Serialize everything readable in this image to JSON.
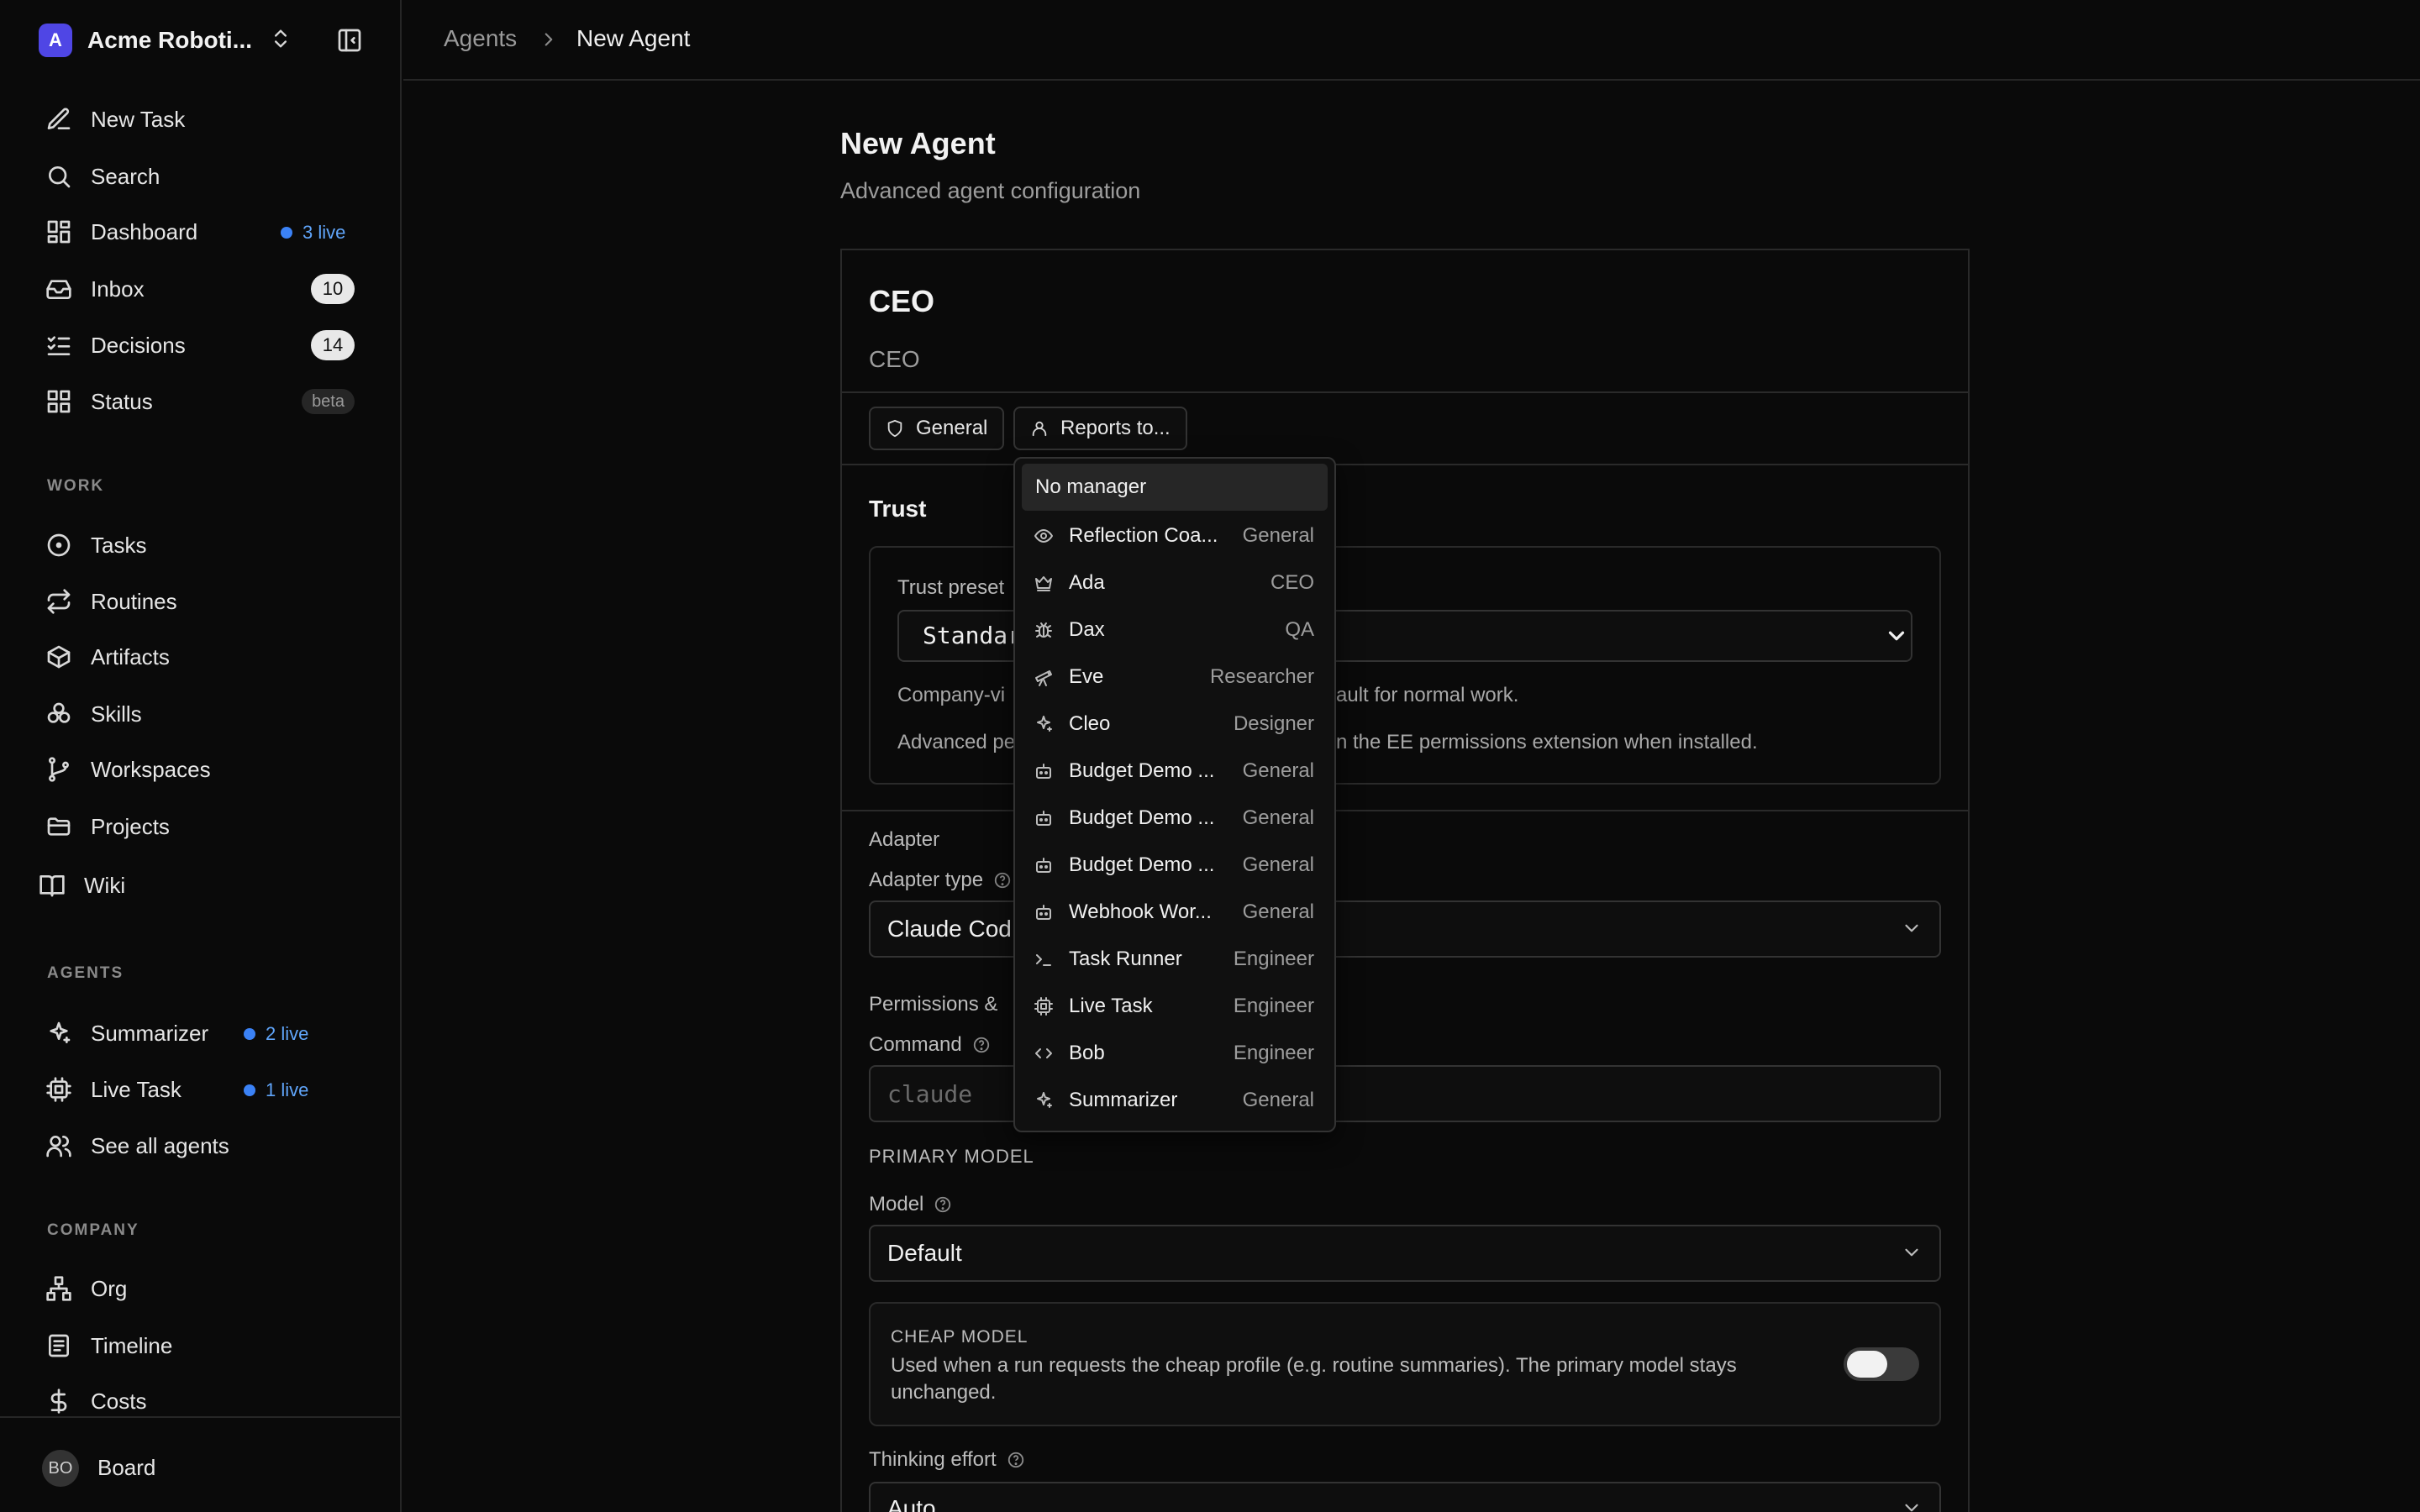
{
  "workspace": {
    "logo_letter": "A",
    "name": "Acme Roboti..."
  },
  "nav": {
    "new_task": "New Task",
    "search": "Search",
    "dashboard": "Dashboard",
    "dashboard_live": "3 live",
    "inbox": "Inbox",
    "inbox_count": "10",
    "decisions": "Decisions",
    "decisions_count": "14",
    "status": "Status",
    "status_badge": "beta"
  },
  "work": {
    "title": "WORK",
    "tasks": "Tasks",
    "routines": "Routines",
    "artifacts": "Artifacts",
    "skills": "Skills",
    "workspaces": "Workspaces",
    "projects": "Projects",
    "wiki": "Wiki"
  },
  "agents_section": {
    "title": "AGENTS",
    "summarizer": "Summarizer",
    "summarizer_live": "2 live",
    "live_task": "Live Task",
    "live_task_live": "1 live",
    "see_all": "See all agents"
  },
  "company": {
    "title": "COMPANY",
    "org": "Org",
    "timeline": "Timeline",
    "costs": "Costs"
  },
  "user": {
    "initials": "BO",
    "name": "Board"
  },
  "breadcrumb": {
    "parent": "Agents",
    "current": "New Agent"
  },
  "page": {
    "title": "New Agent",
    "subtitle": "Advanced agent configuration"
  },
  "agent": {
    "name": "CEO",
    "title": "CEO",
    "chip_general": "General",
    "chip_reports_to": "Reports to..."
  },
  "trust": {
    "title": "Trust",
    "preset_label": "Trust preset",
    "preset_value": "Standar",
    "desc1_left": "Company-vi",
    "desc1_right": "ault for normal work.",
    "desc2_left": "Advanced pe",
    "desc2_right": "n the EE permissions extension when installed."
  },
  "adapter": {
    "section": "Adapter",
    "type_label": "Adapter type",
    "type_value": "Claude Cod",
    "permissions_label": "Permissions &",
    "command_label": "Command",
    "command_placeholder": "claude",
    "primary_model": "PRIMARY MODEL",
    "model_label": "Model",
    "model_value": "Default",
    "cheap_title": "CHEAP MODEL",
    "cheap_desc": "Used when a run requests the cheap profile (e.g. routine summaries). The primary model stays unchanged.",
    "cheap_enabled": false,
    "thinking_label": "Thinking effort",
    "thinking_value": "Auto"
  },
  "dropdown": {
    "no_manager": "No manager",
    "items": [
      {
        "name": "Reflection Coa...",
        "role": "General",
        "icon": "eye-icon"
      },
      {
        "name": "Ada",
        "role": "CEO",
        "icon": "crown-icon"
      },
      {
        "name": "Dax",
        "role": "QA",
        "icon": "bug-icon"
      },
      {
        "name": "Eve",
        "role": "Researcher",
        "icon": "telescope-icon"
      },
      {
        "name": "Cleo",
        "role": "Designer",
        "icon": "sparkles-icon"
      },
      {
        "name": "Budget Demo ...",
        "role": "General",
        "icon": "bot-icon"
      },
      {
        "name": "Budget Demo ...",
        "role": "General",
        "icon": "bot-icon"
      },
      {
        "name": "Budget Demo ...",
        "role": "General",
        "icon": "bot-icon"
      },
      {
        "name": "Webhook Wor...",
        "role": "General",
        "icon": "bot-icon"
      },
      {
        "name": "Task Runner",
        "role": "Engineer",
        "icon": "terminal-icon"
      },
      {
        "name": "Live Task",
        "role": "Engineer",
        "icon": "cpu-icon"
      },
      {
        "name": "Bob",
        "role": "Engineer",
        "icon": "code-icon"
      },
      {
        "name": "Summarizer",
        "role": "General",
        "icon": "sparkles-icon"
      }
    ]
  },
  "colors": {
    "accent": "#3b82f6",
    "brand": "#4f46e5",
    "background": "#0a0a0a"
  }
}
